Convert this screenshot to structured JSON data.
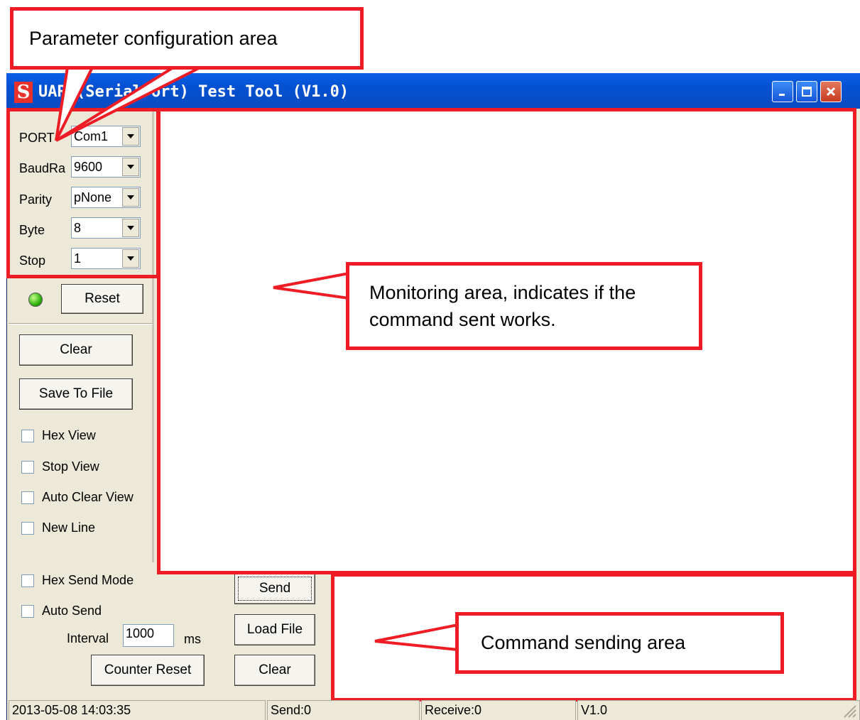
{
  "callouts": {
    "parameter": "Parameter configuration area",
    "monitoring_line1": "Monitoring area, indicates if the",
    "monitoring_line2": "command sent works.",
    "command": "Command sending area"
  },
  "window": {
    "title": "UART(SerialPort) Test Tool (V1.0)",
    "icon_letter": "S"
  },
  "config": {
    "port_label": "PORT",
    "port_value": "Com1",
    "baud_label": "BaudRa",
    "baud_value": "9600",
    "parity_label": "Parity",
    "parity_value": "pNone",
    "byte_label": "Byte",
    "byte_value": "8",
    "stop_label": "Stop",
    "stop_value": "1"
  },
  "buttons": {
    "reset": "Reset",
    "clear_view": "Clear",
    "save_to_file": "Save To File",
    "send": "Send",
    "load_file": "Load File",
    "counter_reset": "Counter Reset",
    "clear_send": "Clear"
  },
  "options": {
    "hex_view": "Hex View",
    "stop_view": "Stop View",
    "auto_clear_view": "Auto Clear View",
    "new_line": "New Line",
    "hex_send_mode": "Hex Send Mode",
    "auto_send": "Auto Send"
  },
  "interval": {
    "label": "Interval",
    "value": "1000",
    "unit": "ms"
  },
  "status": {
    "datetime": "2013-05-08 14:03:35",
    "send": "Send:0",
    "receive": "Receive:0",
    "version": "V1.0"
  },
  "colors": {
    "callout_red": "#ee1c24",
    "titlebar_blue": "#0451d0",
    "led_green": "#2fb20d"
  }
}
